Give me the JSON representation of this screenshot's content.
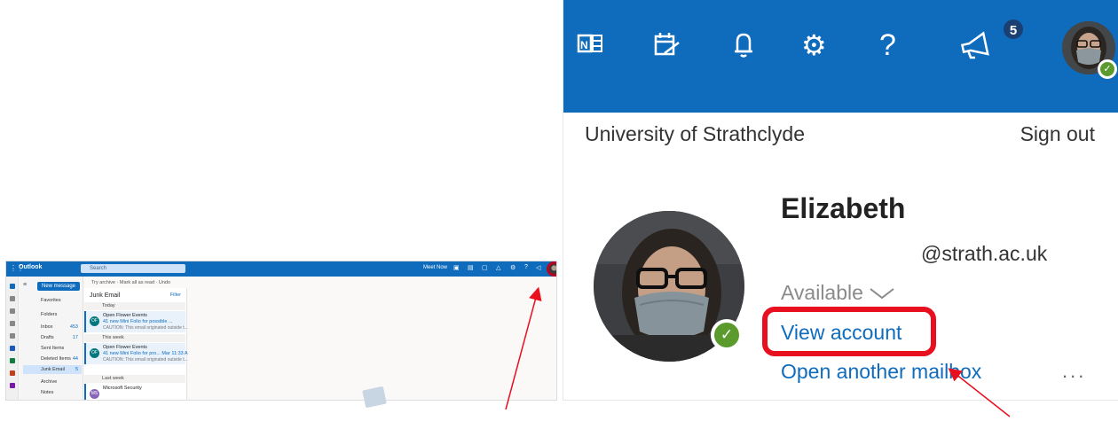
{
  "mini": {
    "brand": "Outlook",
    "search_placeholder": "Search",
    "meet_now": "Meet Now",
    "new_message": "New message",
    "command_bar": "Try archive  ·  Mark all as read  ·  Undo",
    "folders": [
      {
        "label": "Favorites",
        "count": ""
      },
      {
        "label": "Folders",
        "count": ""
      },
      {
        "label": "Inbox",
        "count": "453"
      },
      {
        "label": "Drafts",
        "count": "17"
      },
      {
        "label": "Sent Items",
        "count": ""
      },
      {
        "label": "Deleted Items",
        "count": "44"
      },
      {
        "label": "Junk Email",
        "count": "5"
      },
      {
        "label": "Archive",
        "count": ""
      },
      {
        "label": "Notes",
        "count": ""
      }
    ],
    "list_title": "Junk Email",
    "filter": "Filter",
    "groups": [
      "Today",
      "This week",
      "Last week"
    ],
    "items": [
      {
        "from": "Open Flower Events",
        "subject": "41 new Mini Folio for possible ...",
        "preview": "CAUTION: This email originated outside t..."
      },
      {
        "from": "Open Flower Events",
        "subject": "41 new Mini Folio for pro...  Mar 11:33 AM",
        "preview": "CAUTION: This email originated outside t..."
      },
      {
        "from": "Microsoft Security",
        "subject": "",
        "preview": ""
      }
    ]
  },
  "panel": {
    "notification_count": "5",
    "organization": "University of Strathclyde",
    "sign_out": "Sign out",
    "name": "Elizabeth",
    "email": "@strath.ac.uk",
    "presence": "Available",
    "view_account": "View account",
    "open_another_mailbox": "Open another mailbox",
    "more": "..."
  },
  "colors": {
    "outlook_blue": "#0f6cbd",
    "annotation_red": "#e8101f",
    "presence_green": "#5b9b2e"
  },
  "icons": [
    "onenote-icon",
    "my-day-icon",
    "bell-icon",
    "settings-icon",
    "help-icon",
    "feedback-icon"
  ]
}
